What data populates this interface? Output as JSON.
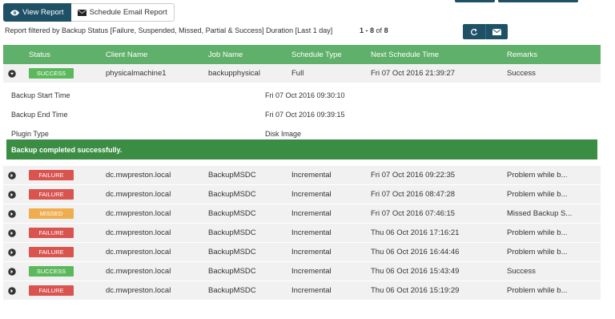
{
  "tabs": {
    "view_report": "View Report",
    "schedule_email": "Schedule Email Report"
  },
  "filter_text": "Report filtered by Backup Status [Failure, Suspended, Missed, Partial & Success] Duration [Last 1 day]",
  "pager": {
    "range": "1 - 8",
    "of": "of",
    "total": "8"
  },
  "columns": {
    "status": "Status",
    "client": "Client Name",
    "job": "Job Name",
    "type": "Schedule Type",
    "next": "Next Schedule Time",
    "remarks": "Remarks"
  },
  "colors": {
    "success": "#5cb85c",
    "failure": "#d9534f",
    "missed": "#f0ad4e",
    "header": "#5fb06a",
    "primary": "#1e5066"
  },
  "rows": [
    {
      "status": "SUCCESS",
      "status_kind": "success",
      "client": "physicalmachine1",
      "job": "backupphysical",
      "type": "Full",
      "next": "Fri 07 Oct 2016 21:39:27",
      "remarks": "Success"
    },
    {
      "status": "FAILURE",
      "status_kind": "failure",
      "client": "dc.mwpreston.local",
      "job": "BackupMSDC",
      "type": "Incremental",
      "next": "Fri 07 Oct 2016 09:22:35",
      "remarks": "Problem while b..."
    },
    {
      "status": "FAILURE",
      "status_kind": "failure",
      "client": "dc.mwpreston.local",
      "job": "BackupMSDC",
      "type": "Incremental",
      "next": "Fri 07 Oct 2016 08:47:28",
      "remarks": "Problem while b..."
    },
    {
      "status": "MISSED",
      "status_kind": "missed",
      "client": "dc.mwpreston.local",
      "job": "BackupMSDC",
      "type": "Incremental",
      "next": "Fri 07 Oct 2016 07:46:15",
      "remarks": "Missed Backup S..."
    },
    {
      "status": "FAILURE",
      "status_kind": "failure",
      "client": "dc.mwpreston.local",
      "job": "BackupMSDC",
      "type": "Incremental",
      "next": "Thu 06 Oct 2016 17:16:21",
      "remarks": "Problem while b..."
    },
    {
      "status": "FAILURE",
      "status_kind": "failure",
      "client": "dc.mwpreston.local",
      "job": "BackupMSDC",
      "type": "Incremental",
      "next": "Thu 06 Oct 2016 16:44:46",
      "remarks": "Problem while b..."
    },
    {
      "status": "SUCCESS",
      "status_kind": "success",
      "client": "dc.mwpreston.local",
      "job": "BackupMSDC",
      "type": "Incremental",
      "next": "Thu 06 Oct 2016 15:43:49",
      "remarks": "Success"
    },
    {
      "status": "FAILURE",
      "status_kind": "failure",
      "client": "dc.mwpreston.local",
      "job": "BackupMSDC",
      "type": "Incremental",
      "next": "Thu 06 Oct 2016 15:19:29",
      "remarks": "Problem while b..."
    }
  ],
  "detail": {
    "start_label": "Backup Start Time",
    "start_value": "Fri 07 Oct 2016 09:30:10",
    "end_label": "Backup End Time",
    "end_value": "Fri 07 Oct 2016 09:39:15",
    "plugin_label": "Plugin Type",
    "plugin_value": "Disk Image",
    "message": "Backup completed successfully."
  }
}
